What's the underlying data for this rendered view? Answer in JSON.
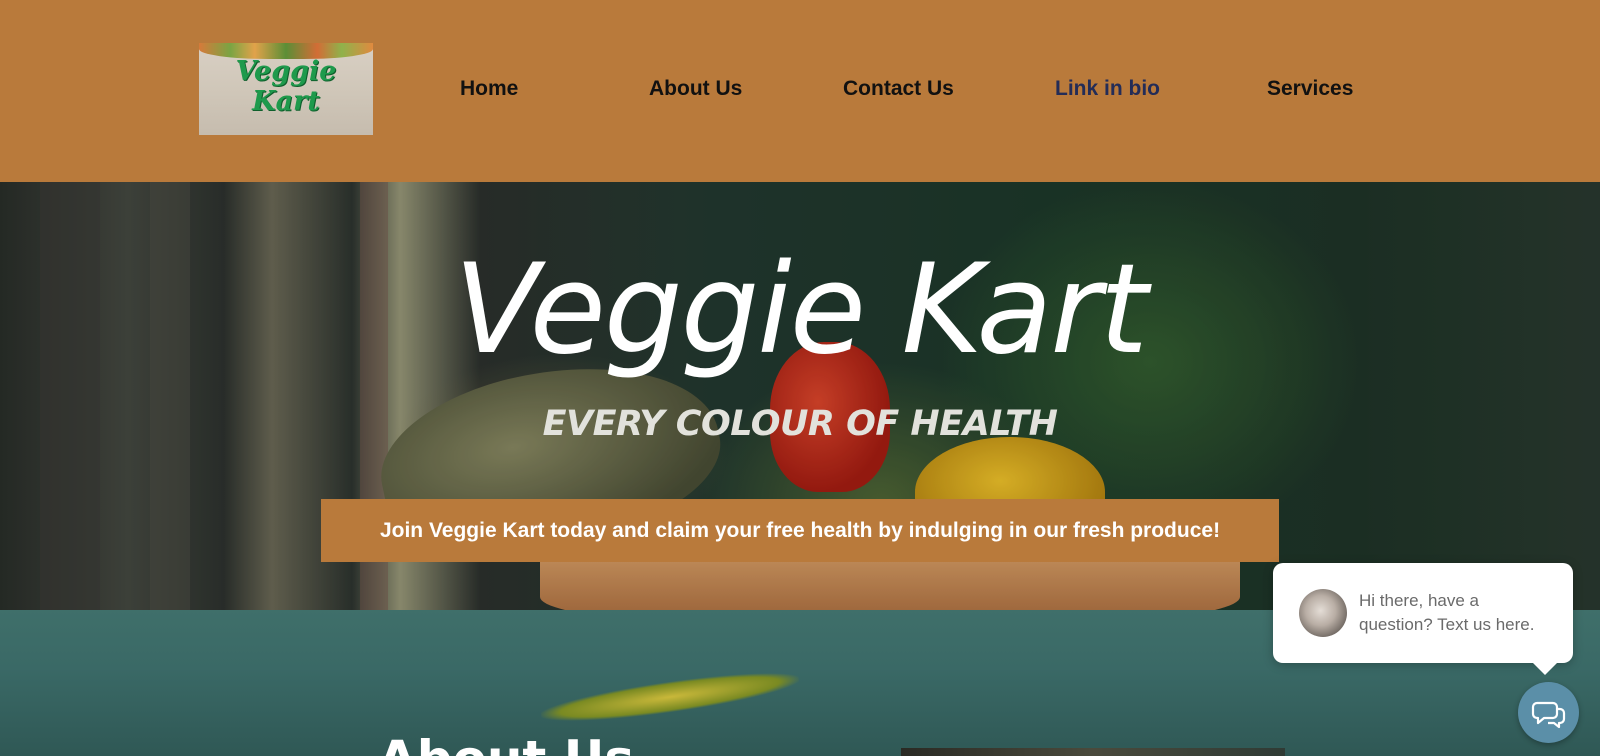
{
  "header": {
    "logo": {
      "line1": "Veggie",
      "line2": "Kart"
    },
    "nav": [
      {
        "label": "Home",
        "active": false
      },
      {
        "label": "About Us",
        "active": false
      },
      {
        "label": "Contact Us",
        "active": false
      },
      {
        "label": "Link in bio",
        "active": true
      },
      {
        "label": "Services",
        "active": false
      }
    ]
  },
  "hero": {
    "title": "Veggie Kart",
    "subtitle": "EVERY COLOUR OF HEALTH",
    "cta_label": "Join Veggie Kart today and claim your free health by indulging in our fresh produce!"
  },
  "about": {
    "heading": "About Us"
  },
  "chat": {
    "message": "Hi there, have a question? Text us here.",
    "icon": "chat-bubbles-icon"
  },
  "colors": {
    "header_bg": "#b97a3b",
    "active_nav": "#232c57",
    "chat_button": "#5b8fa8"
  }
}
